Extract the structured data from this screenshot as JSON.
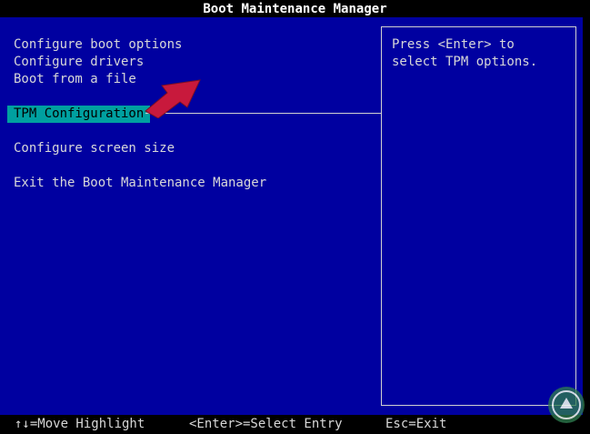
{
  "window": {
    "title": "Boot Maintenance Manager"
  },
  "menu": {
    "items": [
      {
        "label": "Configure boot options"
      },
      {
        "label": "Configure drivers"
      },
      {
        "label": "Boot from a file"
      },
      {
        "label": "TPM Configuration",
        "selected": true
      },
      {
        "label": "Configure screen size"
      },
      {
        "label": "Exit the Boot Maintenance Manager"
      }
    ]
  },
  "help": {
    "text": "Press <Enter> to\nselect TPM options."
  },
  "status_bar": {
    "move_hint": "↑↓=Move Highlight",
    "enter_hint": "<Enter>=Select Entry",
    "esc_hint": "Esc=Exit"
  },
  "annotation": {
    "arrow_color": "#C8193C",
    "arrow_icon": "red-pointer-arrow"
  },
  "colors": {
    "background": "#0000A0",
    "highlight": "#00A0A0",
    "text": "#D8D8D8",
    "title_text": "#FFFFFF"
  }
}
